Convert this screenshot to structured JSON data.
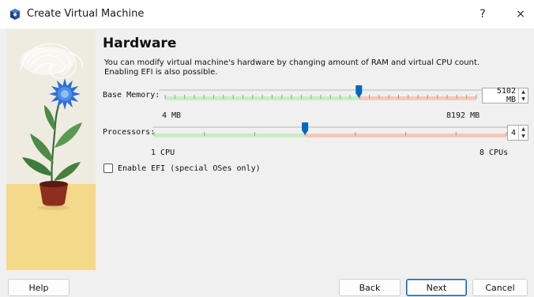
{
  "window": {
    "title": "Create Virtual Machine",
    "help_glyph": "?",
    "close_glyph": "×",
    "icon": "virtualbox-cube-icon"
  },
  "page": {
    "title": "Hardware",
    "description_line1": "You can modify virtual machine's hardware by changing amount of RAM and virtual CPU count.",
    "description_line2": "Enabling EFI is also possible."
  },
  "memory": {
    "label": "Base Memory:",
    "min_label": "4 MB",
    "max_label": "8192 MB",
    "value": 5102,
    "value_text": "5102 MB",
    "min": 4,
    "max": 8192,
    "recommended_max": 5120
  },
  "processors": {
    "label": "Processors:",
    "min_label": "1 CPU",
    "max_label": "8 CPUs",
    "value": 4,
    "value_text": "4",
    "min": 1,
    "max": 8,
    "recommended_max": 4
  },
  "efi": {
    "label": "Enable EFI (special OSes only)",
    "checked": false
  },
  "buttons": {
    "help": "Help",
    "back": "Back",
    "next": "Next",
    "cancel": "Cancel"
  },
  "colors": {
    "slider_ok": "#c9ecc4",
    "slider_warn": "#f6c8b8",
    "slider_handle": "#0067c0",
    "accent": "#0067c0"
  }
}
